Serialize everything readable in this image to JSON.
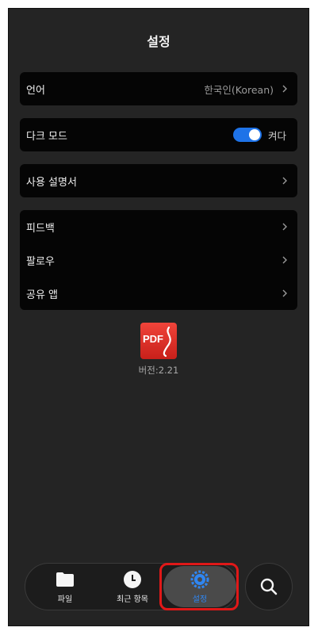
{
  "header": {
    "title": "설정"
  },
  "settings": {
    "language": {
      "label": "언어",
      "value": "한국인(Korean)"
    },
    "dark_mode": {
      "label": "다크 모드",
      "state_text": "켜다",
      "enabled": true
    },
    "manual": {
      "label": "사용 설명서"
    },
    "group": {
      "feedback": "피드백",
      "follow": "팔로우",
      "share": "공유 앱"
    }
  },
  "about": {
    "logo_text": "PDF",
    "version": "버전:2.21"
  },
  "bottom_nav": {
    "tabs": [
      {
        "label": "파일",
        "icon": "folder-icon"
      },
      {
        "label": "최근 항목",
        "icon": "clock-icon"
      },
      {
        "label": "설정",
        "icon": "gear-icon",
        "active": true
      }
    ],
    "search_icon": "search-icon"
  },
  "colors": {
    "accent": "#2f86f2",
    "toggle": "#1e73e8",
    "highlight": "#e01818",
    "background": "#242424",
    "card": "#050505"
  }
}
